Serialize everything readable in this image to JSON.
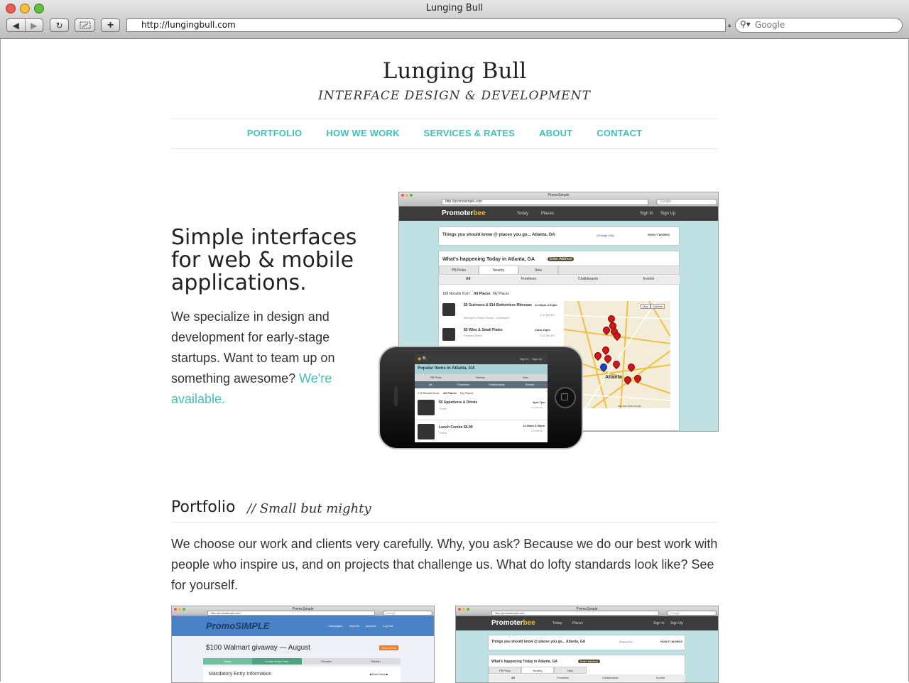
{
  "browser": {
    "window_title": "Lunging Bull",
    "url": "http://lungingbull.com",
    "search_placeholder": "Google",
    "back": "◀",
    "forward": "▶",
    "reload": "↻",
    "add_tab": "+"
  },
  "site": {
    "title": "Lunging Bull",
    "tagline": "INTERFACE DESIGN & DEVELOPMENT",
    "nav": [
      "PORTFOLIO",
      "HOW WE WORK",
      "SERVICES & RATES",
      "ABOUT",
      "CONTACT"
    ]
  },
  "hero": {
    "heading": "Simple interfaces for web & mobile applications.",
    "body": "We specialize in design and development for early-stage startups. Want to team up on something awesome?",
    "link": "We're available."
  },
  "screenshot": {
    "window_title": "PromoSimple",
    "url": "http://promosimple.com",
    "search": "Google",
    "logo_a": "Promoter",
    "logo_b": "bee",
    "nav": [
      "Today",
      "Places"
    ],
    "auth": [
      "Sign In",
      "Sign Up"
    ],
    "notice": "Things you should know @ places you go... Atlanta, GA",
    "notice_link": "(Change City)",
    "how_it_works": "HOW IT WORKS",
    "happening": "What's happening Today in Atlanta, GA",
    "enter_address": "Enter Address",
    "tabs": [
      "PB Picks",
      "Nearby",
      "New"
    ],
    "filters": [
      "All",
      "Freebees",
      "Chalkboards",
      "Events"
    ],
    "results": "189 Results from:",
    "results_all": "All Places",
    "results_mine": "My Places",
    "deals": [
      {
        "title": "$5 Guinness & $14 Bottomless Mimosas",
        "place": "Meehan's Public House - Downtown",
        "time": "12:30pm-3:30pm",
        "dist": "0.43 MILES"
      },
      {
        "title": "$5 Wine & Small Plates",
        "place": "Peasant Bistro",
        "time": "11am-10pm",
        "dist": "0.43 MILES"
      }
    ],
    "map_btns": [
      "Map",
      "Satellite"
    ],
    "map_city": "Atlanta",
    "map_footer": "Map data ©2012 Google"
  },
  "phone": {
    "auth": [
      "Sign In",
      "Sign Up"
    ],
    "header": "Popular Items in Atlanta, GA",
    "tabs": [
      "PB Picks",
      "Nearby",
      "New"
    ],
    "filters": [
      "All",
      "Freebees",
      "Chalkboards",
      "Events"
    ],
    "results": "278 Results from:",
    "results_all": "All Places",
    "results_mine": "My Places",
    "deals": [
      {
        "title": "$5 Appetizers & Drinks",
        "place": "Thrive",
        "time": "4pm-7pm",
        "dist": "0.43 MILES"
      },
      {
        "title": "Lunch Combo $6.99",
        "place": "Thrive",
        "time": "11:30am-3:00pm",
        "dist": "0.43 MILES"
      }
    ]
  },
  "portfolio": {
    "heading": "Portfolio",
    "subheading": "// Small but mighty",
    "body": "We choose our work and clients very carefully. Why, you ask? Because we do our best work with people who inspire us, and on projects that challenge us. What do lofty standards look like? See for yourself.",
    "thumb1": {
      "window_title": "PromoSimple",
      "url": "http://promosimple.com",
      "search": "Google",
      "logo": "PromoSIMPLE",
      "nav": [
        "Campaigns",
        "Reports",
        "Account",
        "Log Out"
      ],
      "campaign": "$100 Walmart givaway — August",
      "button": "Save & Exit",
      "steps": [
        "Setup",
        "Create Entry Form",
        "Preview",
        "Publish"
      ],
      "section": "Mandatory Entry Information",
      "pager": "◀ Back  Next ▶"
    },
    "thumb2": {
      "window_title": "PromoSimple",
      "url": "http://promosimple.com",
      "search": "Google",
      "logo_a": "Promoter",
      "logo_b": "bee",
      "nav": [
        "Today",
        "Places"
      ],
      "auth": [
        "Sign In",
        "Sign Up"
      ],
      "notice": "Things you should know @ places you go... Atlanta, GA",
      "notice_link": "(Change City)",
      "how_it_works": "HOW IT WORKS",
      "happening": "What's happening Today in Atlanta, GA",
      "enter_address": "Enter Address",
      "tabs": [
        "PB Picks",
        "Nearby",
        "New"
      ],
      "filters": [
        "All",
        "Freebees",
        "Chalkboards",
        "Events"
      ]
    }
  },
  "colors": {
    "accent": "#3fc3b8",
    "text": "#333333",
    "mock_bg": "#bfe1e3",
    "header_dark": "#3c3c3c"
  }
}
